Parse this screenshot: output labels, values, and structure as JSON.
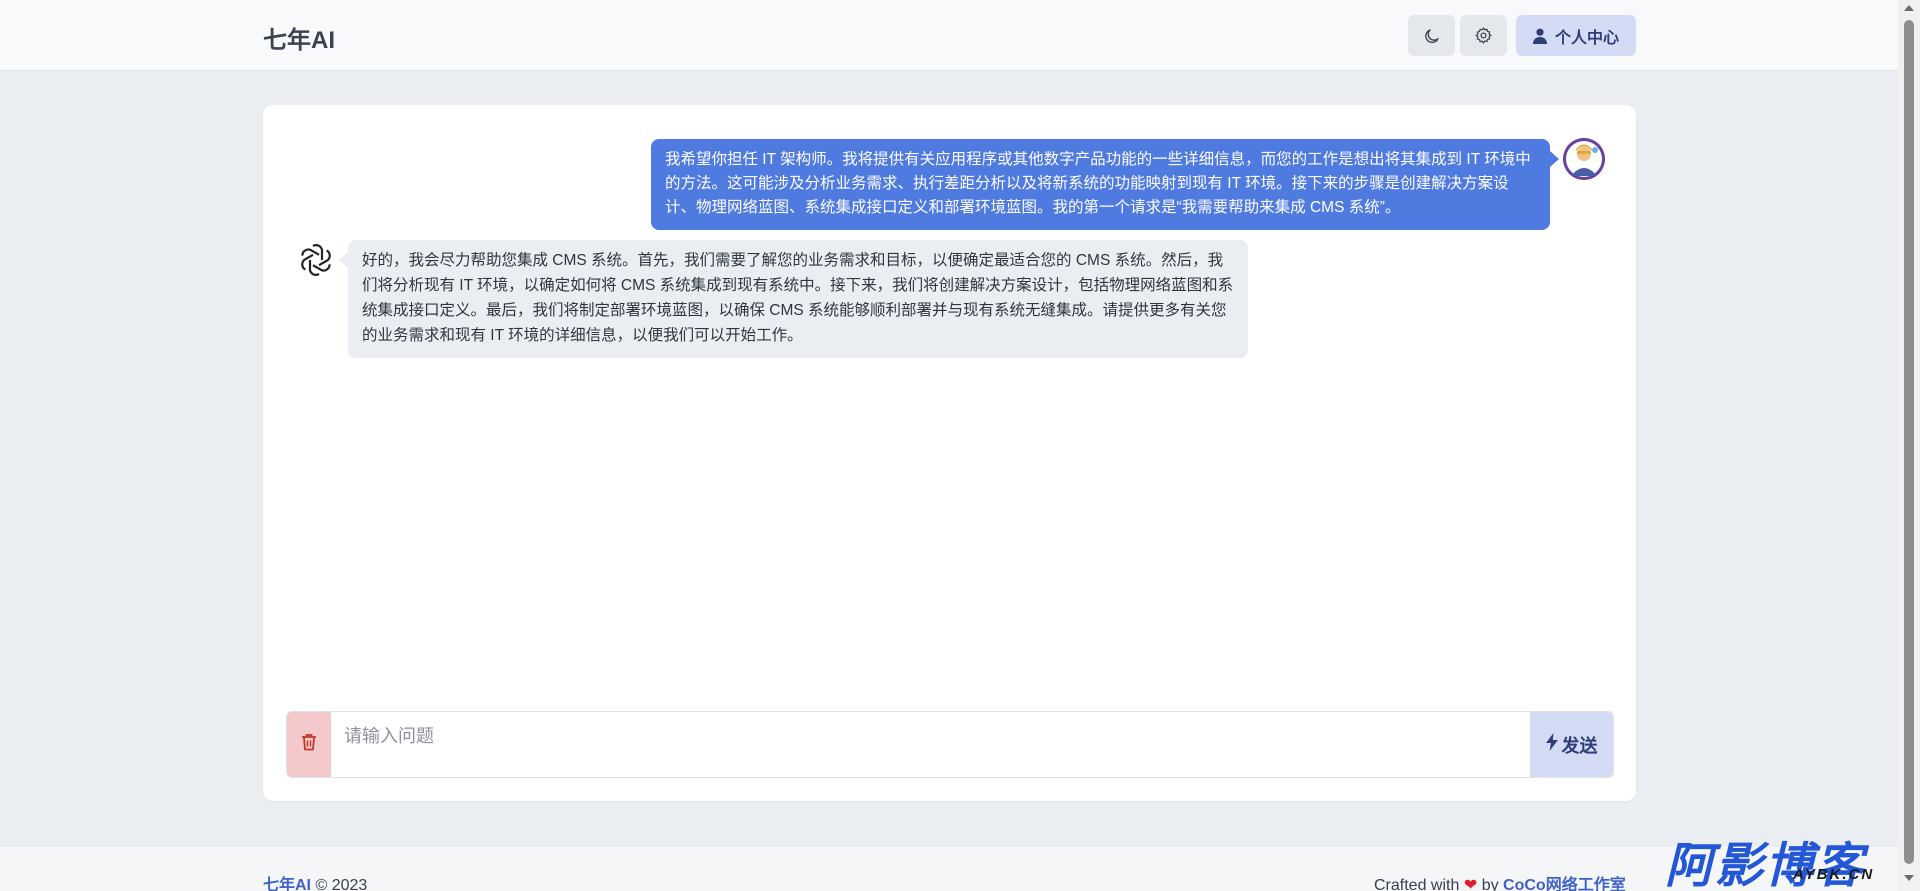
{
  "header": {
    "brand": "七年AI",
    "profile_label": "个人中心",
    "icons": [
      "moon-icon",
      "gear-icon",
      "user-icon"
    ]
  },
  "chat": {
    "messages": [
      {
        "role": "user",
        "text": "我希望你担任 IT 架构师。我将提供有关应用程序或其他数字产品功能的一些详细信息，而您的工作是想出将其集成到 IT 环境中的方法。这可能涉及分析业务需求、执行差距分析以及将新系统的功能映射到现有 IT 环境。接下来的步骤是创建解决方案设计、物理网络蓝图、系统集成接口定义和部署环境蓝图。我的第一个请求是“我需要帮助来集成 CMS 系统”。"
      },
      {
        "role": "assistant",
        "text": "好的，我会尽力帮助您集成 CMS 系统。首先，我们需要了解您的业务需求和目标，以便确定最适合您的 CMS 系统。然后，我们将分析现有 IT 环境，以确定如何将 CMS 系统集成到现有系统中。接下来，我们将创建解决方案设计，包括物理网络蓝图和系统集成接口定义。最后，我们将制定部署环境蓝图，以确保 CMS 系统能够顺利部署并与现有系统无缝集成。请提供更多有关您的业务需求和现有 IT 环境的详细信息，以便我们可以开始工作。"
      }
    ]
  },
  "input": {
    "placeholder": "请输入问题",
    "value": "",
    "send_label": "发送"
  },
  "footer": {
    "brand_link": "七年AI",
    "copyright": "© 2023",
    "crafted_prefix": "Crafted with",
    "heart": "❤",
    "by": "by",
    "studio_link": "CoCo网络工作室"
  },
  "watermark": {
    "main": "阿影博客",
    "sub": "AYBK.CN"
  },
  "colors": {
    "user_bubble": "#4f7ae0",
    "bot_bubble": "#eaedf2",
    "accent": "#3f62c9",
    "trash_bg": "#f3c9cb",
    "send_bg": "#d4dcf5"
  }
}
